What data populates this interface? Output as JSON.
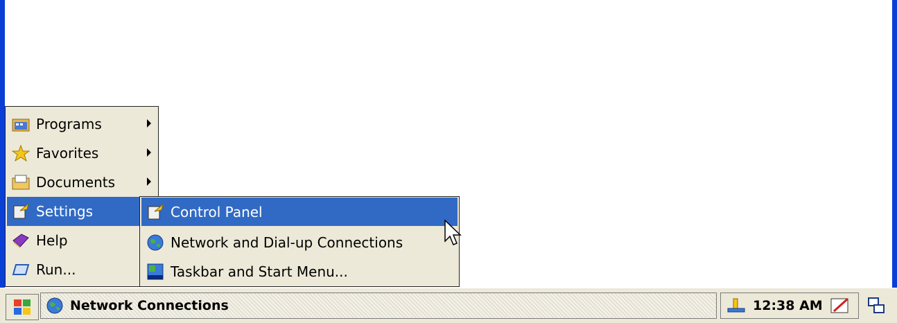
{
  "start_menu": {
    "items": [
      {
        "label": "Programs",
        "icon": "programs-folder-icon",
        "has_submenu": true
      },
      {
        "label": "Favorites",
        "icon": "favorites-star-icon",
        "has_submenu": true
      },
      {
        "label": "Documents",
        "icon": "documents-folder-icon",
        "has_submenu": true
      },
      {
        "label": "Settings",
        "icon": "settings-icon",
        "has_submenu": false
      },
      {
        "label": "Help",
        "icon": "help-book-icon",
        "has_submenu": false
      },
      {
        "label": "Run...",
        "icon": "run-icon",
        "has_submenu": false
      }
    ]
  },
  "settings_submenu": {
    "items": [
      {
        "label": "Control Panel",
        "icon": "control-panel-icon"
      },
      {
        "label": "Network and Dial-up Connections",
        "icon": "network-globe-icon"
      },
      {
        "label": "Taskbar and Start Menu...",
        "icon": "taskbar-icon"
      }
    ]
  },
  "taskbar": {
    "task_button_label": "Network Connections",
    "clock": "12:38 AM"
  },
  "colors": {
    "selection": "#316ac5",
    "menu_bg": "#ece9d8",
    "frame": "#0a3fd6"
  }
}
